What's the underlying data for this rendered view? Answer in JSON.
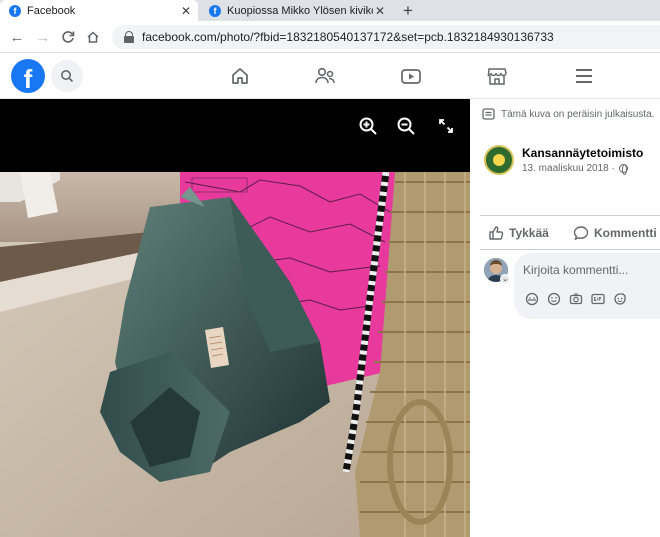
{
  "browser": {
    "tabs": [
      {
        "title": "Facebook",
        "active": true
      },
      {
        "title": "Kuopiossa Mikko Ylösen kivikokoelma",
        "active": false
      }
    ],
    "url": "facebook.com/photo/?fbid=1832180540137172&set=pcb.1832184930136733"
  },
  "fbnav": {
    "icons": [
      "home-icon",
      "friends-icon",
      "watch-icon",
      "marketplace-icon",
      "menu-icon"
    ],
    "accent": "#1877f2"
  },
  "side": {
    "notice": "Tämä kuva on peräisin julkaisusta.",
    "author": "Kansannäytetoimisto",
    "date": "13. maaliskuu 2018 · ",
    "like_label": "Tykkää",
    "comment_label": "Kommentti",
    "comment_placeholder": "Kirjoita kommentti..."
  }
}
